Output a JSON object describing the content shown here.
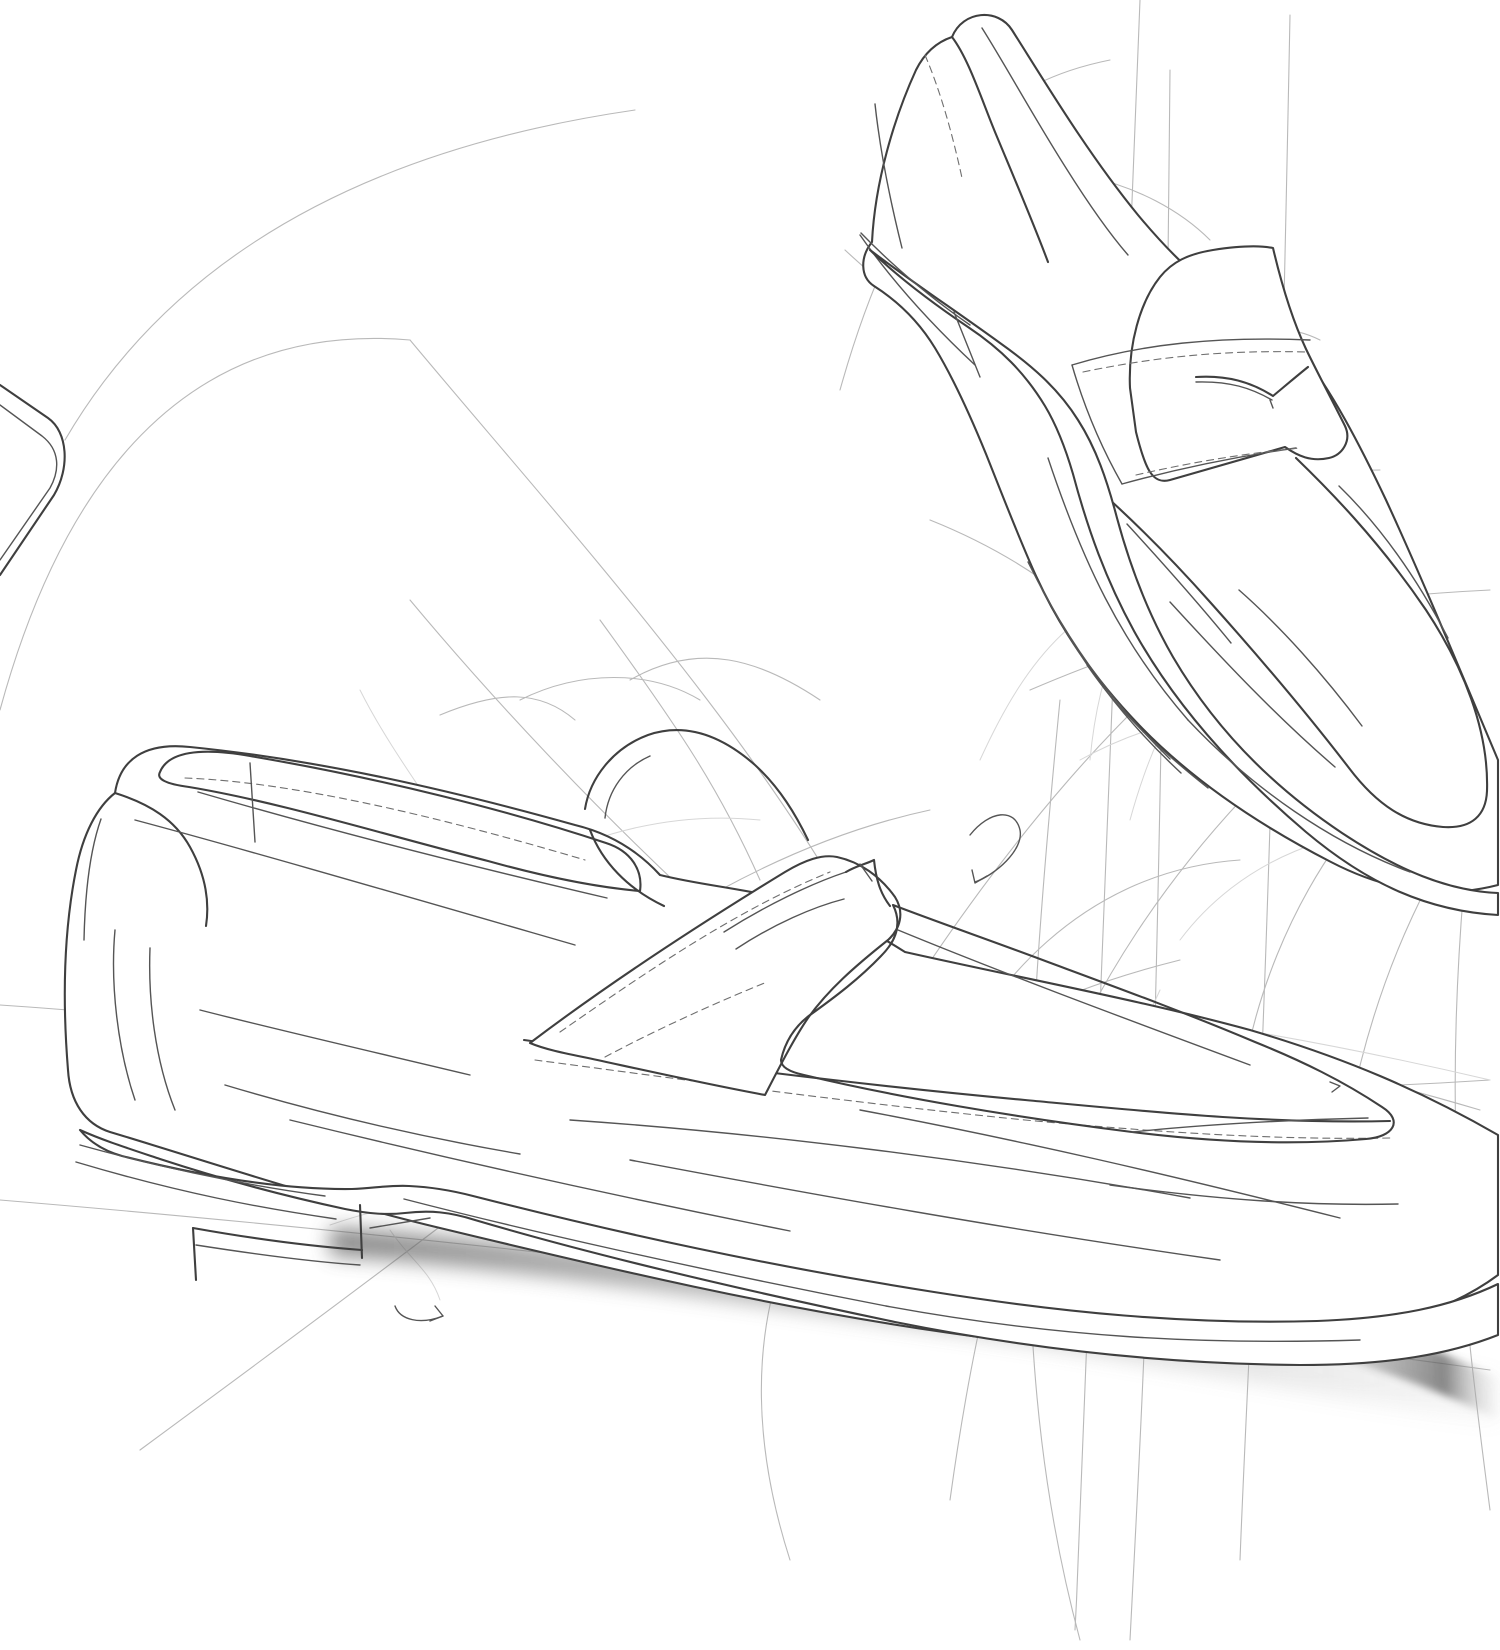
{
  "scene": {
    "background_color": "#ffffff",
    "line_color": "#3f3f3f",
    "guide_color": "#b9b9b9",
    "shadow_color": "#6a6a6a"
  },
  "objects": [
    "left-edge-partial-shoe",
    "main-penny-loafer",
    "secondary-penny-loafer"
  ]
}
